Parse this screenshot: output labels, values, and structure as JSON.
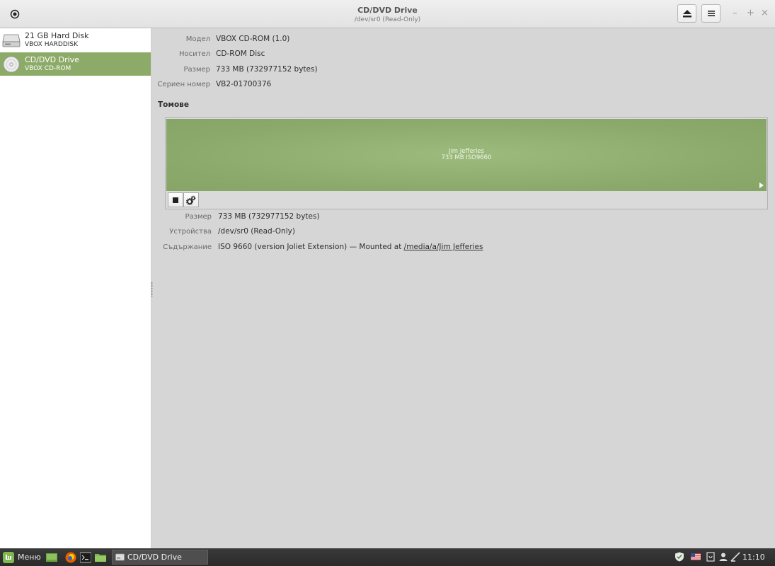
{
  "window": {
    "title": "CD/DVD Drive",
    "subtitle": "/dev/sr0 (Read-Only)"
  },
  "sidebar": {
    "items": [
      {
        "name": "21 GB Hard Disk",
        "subtitle": "VBOX HARDDISK",
        "icon": "hard-disk-icon",
        "selected": false
      },
      {
        "name": "CD/DVD Drive",
        "subtitle": "VBOX CD-ROM",
        "icon": "optical-disc-icon",
        "selected": true
      }
    ]
  },
  "drive": {
    "model_label": "Модел",
    "model_value": "VBOX CD-ROM (1.0)",
    "media_label": "Носител",
    "media_value": "CD-ROM Disc",
    "size_label": "Размер",
    "size_value": "733 MB (732977152 bytes)",
    "serial_label": "Сериен номер",
    "serial_value": "VB2-01700376"
  },
  "volumes": {
    "title": "Томове",
    "block_name": "Jim Jefferies",
    "block_desc": "733 MB ISO9660"
  },
  "partition": {
    "size_label": "Размер",
    "size_value": "733 MB (732977152 bytes)",
    "device_label": "Устройства",
    "device_value": "/dev/sr0 (Read-Only)",
    "contents_label": "Съдържание",
    "contents_prefix": "ISO 9660 (version Joliet Extension) — Mounted at ",
    "mount_path": "/media/a/Jim Jefferies"
  },
  "taskbar": {
    "menu_label": "Меню",
    "window_label": "CD/DVD Drive",
    "clock": "11:10"
  },
  "colors": {
    "accent": "#8cab68",
    "volume": "#93b374"
  }
}
